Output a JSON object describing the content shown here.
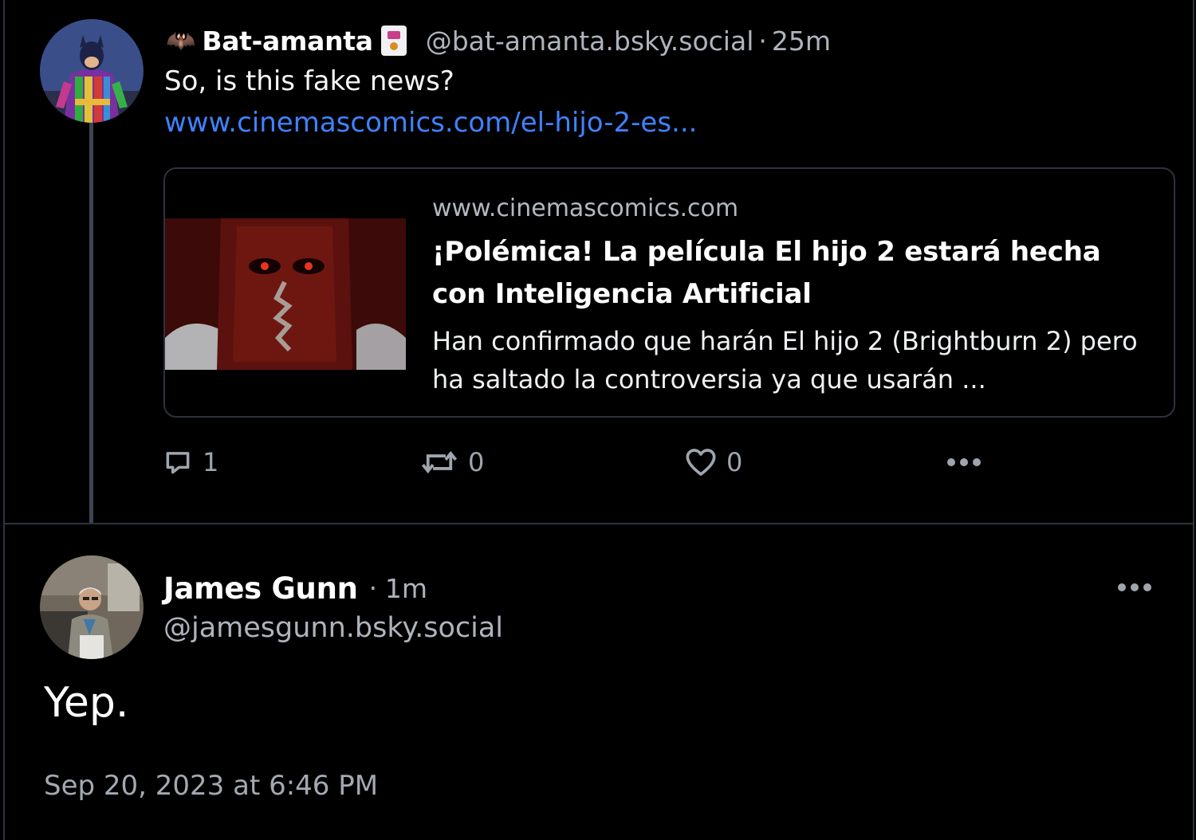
{
  "parent_post": {
    "author": {
      "emoji_prefix": "🦇",
      "display_name": "Bat-amanta",
      "badge_icon": "joker-card-emoji",
      "handle": "@bat-amanta.bsky.social",
      "separator": "·",
      "time": "25m"
    },
    "text": "So, is this fake news?",
    "link_text": "www.cinemascomics.com/el-hijo-2-es...",
    "embed": {
      "domain": "www.cinemascomics.com",
      "title": "¡Polémica! La película El hijo 2 estará hecha con Inteligencia Artificial",
      "description": "Han confirmado que harán El hijo 2 (Brightburn 2) pero ha saltado la controversia ya que usarán ..."
    },
    "actions": {
      "replies": "1",
      "reposts": "0",
      "likes": "0"
    }
  },
  "main_post": {
    "author": {
      "display_name": "James Gunn",
      "separator": "·",
      "time": "1m",
      "handle": "@jamesgunn.bsky.social"
    },
    "text": "Yep.",
    "timestamp": "Sep 20, 2023 at 6:46 PM"
  },
  "icons": [
    "bat-emoji",
    "joker-card-emoji",
    "reply-icon",
    "repost-icon",
    "like-heart-icon",
    "more-options-icon"
  ],
  "colors": {
    "background": "#000000",
    "link": "#3f82ff",
    "muted_text": "#aeb4bd",
    "border": "#2e3440"
  }
}
